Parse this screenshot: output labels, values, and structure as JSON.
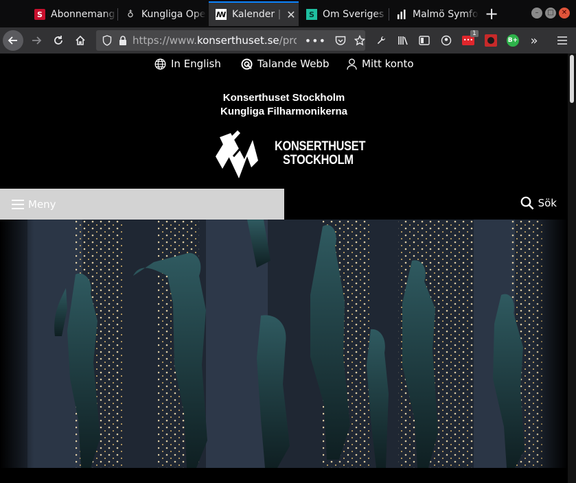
{
  "browser": {
    "tabs": [
      {
        "title": "Abonnemang"
      },
      {
        "title": "Kungliga Ope"
      },
      {
        "title": "Kalender |",
        "active": true
      },
      {
        "title": "Om Sveriges R"
      },
      {
        "title": "Malmö Symfo"
      }
    ],
    "url": {
      "prefix": "https://www.",
      "host": "konserthuset.se",
      "path": "/prog"
    },
    "extension_badge": "1",
    "extension_label": "B+"
  },
  "page": {
    "toplinks": {
      "english": "In English",
      "talande": "Talande Webb",
      "konto": "Mitt konto"
    },
    "org_line1": "Konserthuset Stockholm",
    "org_line2": "Kungliga Filharmonikerna",
    "logo_line1": "KONSERTHUSET",
    "logo_line2": "STOCKHOLM",
    "menu_label": "Meny",
    "search_label": "Sök"
  }
}
